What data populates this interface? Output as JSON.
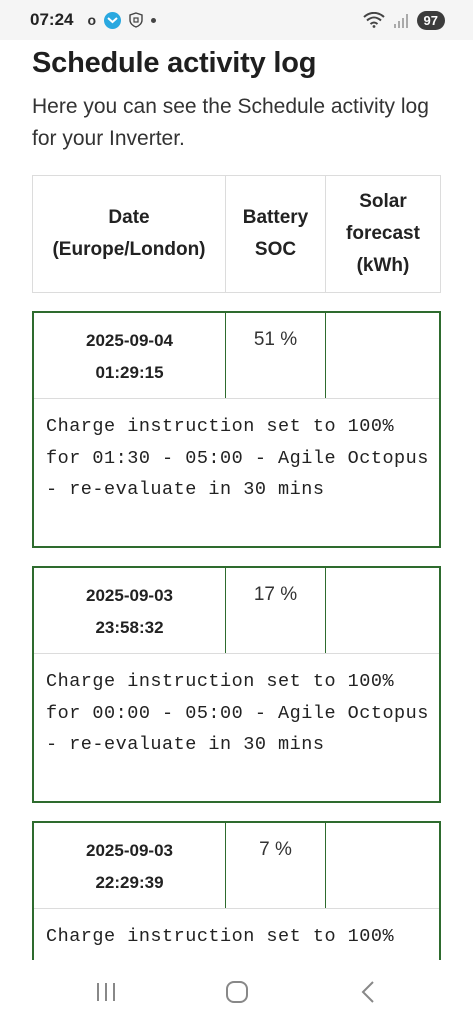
{
  "status_bar": {
    "time": "07:24",
    "notif_o": "o",
    "battery": "97"
  },
  "page": {
    "title": "Schedule activity log",
    "description": "Here you can see the Schedule activity log for your Inverter."
  },
  "table": {
    "headers": {
      "date_line1": "Date",
      "date_line2": "(Europe/London)",
      "battery_line1": "Battery",
      "battery_line2": "SOC",
      "solar_line1": "Solar",
      "solar_line2": "forecast",
      "solar_line3": "(kWh)"
    },
    "rows": [
      {
        "date": "2025-09-04",
        "time": "01:29:15",
        "soc": "51 %",
        "solar": "",
        "message": "Charge instruction set to 100% for 01:30 - 05:00 - Agile Octopus - re-evaluate in 30 mins"
      },
      {
        "date": "2025-09-03",
        "time": "23:58:32",
        "soc": "17 %",
        "solar": "",
        "message": "Charge instruction set to 100% for 00:00 - 05:00 - Agile Octopus - re-evaluate in 30 mins"
      },
      {
        "date": "2025-09-03",
        "time": "22:29:39",
        "soc": "7 %",
        "solar": "",
        "message": "Charge instruction set to 100%"
      }
    ]
  },
  "nav": {
    "recents_icon": "recents-icon",
    "home_icon": "home-icon",
    "back_icon": "back-icon"
  }
}
